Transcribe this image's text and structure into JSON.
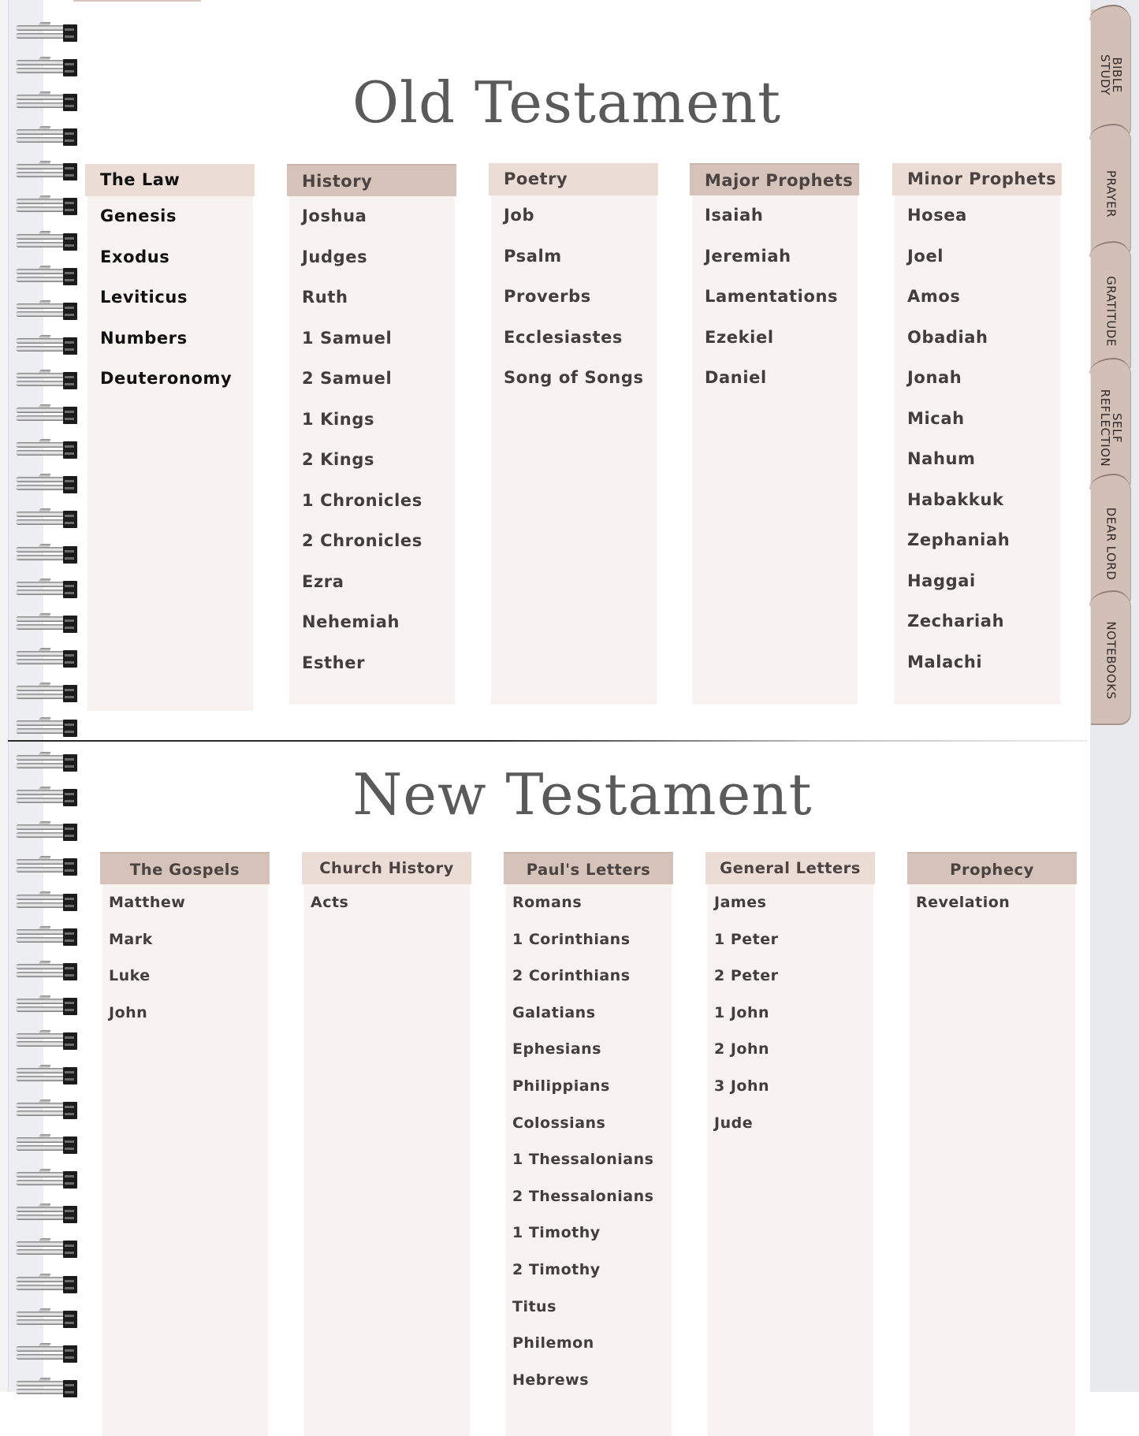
{
  "old_testament": {
    "title": "Old Testament",
    "columns": [
      {
        "header": "The Law",
        "books": [
          "Genesis",
          "Exodus",
          "Leviticus",
          "Numbers",
          "Deuteronomy"
        ]
      },
      {
        "header": "History",
        "books": [
          "Joshua",
          "Judges",
          "Ruth",
          "1 Samuel",
          "2 Samuel",
          "1 Kings",
          "2 Kings",
          "1 Chronicles",
          "2 Chronicles",
          "Ezra",
          "Nehemiah",
          "Esther"
        ]
      },
      {
        "header": "Poetry",
        "books": [
          "Job",
          "Psalm",
          "Proverbs",
          "Ecclesiastes",
          "Song of Songs"
        ]
      },
      {
        "header": "Major Prophets",
        "books": [
          "Isaiah",
          "Jeremiah",
          "Lamentations",
          "Ezekiel",
          "Daniel"
        ]
      },
      {
        "header": "Minor Prophets",
        "books": [
          "Hosea",
          "Joel",
          "Amos",
          "Obadiah",
          "Jonah",
          "Micah",
          "Nahum",
          "Habakkuk",
          "Zephaniah",
          "Haggai",
          "Zechariah",
          "Malachi"
        ]
      }
    ]
  },
  "new_testament": {
    "title": "New Testament",
    "columns": [
      {
        "header": "The Gospels",
        "books": [
          "Matthew",
          "Mark",
          "Luke",
          "John"
        ]
      },
      {
        "header": "Church History",
        "books": [
          "Acts"
        ]
      },
      {
        "header": "Paul's Letters",
        "books": [
          "Romans",
          "1 Corinthians",
          "2 Corinthians",
          "Galatians",
          "Ephesians",
          "Philippians",
          "Colossians",
          "1 Thessalonians",
          "2 Thessalonians",
          "1 Timothy",
          "2 Timothy",
          "Titus",
          "Philemon",
          "Hebrews"
        ]
      },
      {
        "header": "General Letters",
        "books": [
          "James",
          "1 Peter",
          "2 Peter",
          "1 John",
          "2 John",
          "3 John",
          "Jude"
        ]
      },
      {
        "header": "Prophecy",
        "books": [
          "Revelation"
        ]
      }
    ]
  },
  "tabs": [
    {
      "label": "BIBLE\nSTUDY"
    },
    {
      "label": "PRAYER"
    },
    {
      "label": "GRATITUDE"
    },
    {
      "label": "SELF\nREFLECTION"
    },
    {
      "label": "DEAR LORD"
    },
    {
      "label": "NOTEBOOKS"
    }
  ],
  "colors": {
    "header_dark": "#d5c3ba",
    "header_light": "#ecdcd6",
    "column_body": "#f8f3f1",
    "tab": "#d2bfb6",
    "title_text": "#5a5a5a"
  }
}
